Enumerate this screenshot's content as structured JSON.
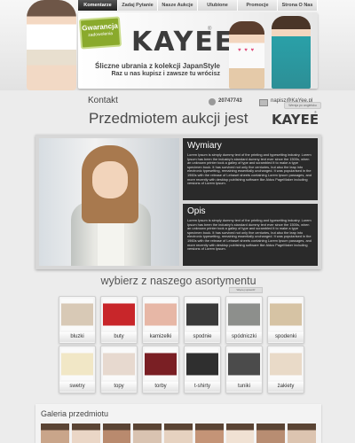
{
  "nav": {
    "items": [
      "Komentarze",
      "Zadaj Pytanie",
      "Nasze Aukcje",
      "Ulubione",
      "Promocje",
      "Strona O Nas"
    ],
    "active": "Komentarze"
  },
  "banner": {
    "badge_title": "Gwarancja",
    "badge_sub": "zadowolenia",
    "logo": "KAYEE",
    "logo_mark": "®",
    "slogan_line1": "Śliczne ubrania z kolekcji JapanStyle",
    "slogan_line2": "Raz u nas kupisz i zawsze tu wrócisz"
  },
  "contact": {
    "label": "Kontakt",
    "phone": "20747743",
    "email": "napisz@KaYee.pl",
    "small_button": "Wersja po angielsku"
  },
  "title": {
    "text": "Przedmiotem aukcji jest",
    "logo": "KAYEE",
    "logo_mark": "®"
  },
  "product": {
    "box1_title": "Wymiary",
    "box1_text": "Lorem Ipsum is simply dummy text of the printing and typesetting industry. Lorem Ipsum has been the industry's standard dummy text ever since the 1500s, when an unknown printer took a galley of type and scrambled it to make a type specimen book. It has survived not only five centuries, but also the leap into electronic typesetting, remaining essentially unchanged. It was popularised in the 1960s with the release of Letraset sheets containing Lorem Ipsum passages, and more recently with desktop publishing software like Aldus PageMaker including versions of Lorem Ipsum.",
    "box2_title": "Opis",
    "box2_text": "Lorem Ipsum is simply dummy text of the printing and typesetting industry. Lorem Ipsum has been the industry's standard dummy text ever since the 1500s, when an unknown printer took a galley of type and scrambled it to make a type specimen book. It has survived not only five centuries, but also the leap into electronic typesetting, remaining essentially unchanged. It was popularised in the 1960s with the release of Letraset sheets containing Lorem Ipsum passages, and more recently with desktop publishing software like Aldus PageMaker including versions of Lorem Ipsum."
  },
  "categories": {
    "heading": "wybierz z naszego asortymentu",
    "button": "Więcej sprawdź",
    "items": [
      {
        "label": "bluzki",
        "color": "#d8c9b6"
      },
      {
        "label": "buty",
        "color": "#c8262a"
      },
      {
        "label": "kamizelki",
        "color": "#e7b7a6"
      },
      {
        "label": "spodnie",
        "color": "#3a3a3a"
      },
      {
        "label": "spódniczki",
        "color": "#8d8f8c"
      },
      {
        "label": "spodenki",
        "color": "#d6c3a4"
      },
      {
        "label": "swetry",
        "color": "#f1e7c6"
      },
      {
        "label": "topy",
        "color": "#e7d9cf"
      },
      {
        "label": "torby",
        "color": "#7a1f24"
      },
      {
        "label": "t-shirty",
        "color": "#2f2f2f"
      },
      {
        "label": "tuniki",
        "color": "#4b4b4b"
      },
      {
        "label": "żakiety",
        "color": "#e9dac8"
      }
    ]
  },
  "gallery": {
    "title": "Galeria przedmiotu",
    "thumbs": [
      "#c9a58a",
      "#ead6c6",
      "#b98a6e",
      "#d9c3b1",
      "#e6d2c0",
      "#c49477",
      "#f0e1d3",
      "#b88d72",
      "#dcc4b0"
    ]
  }
}
